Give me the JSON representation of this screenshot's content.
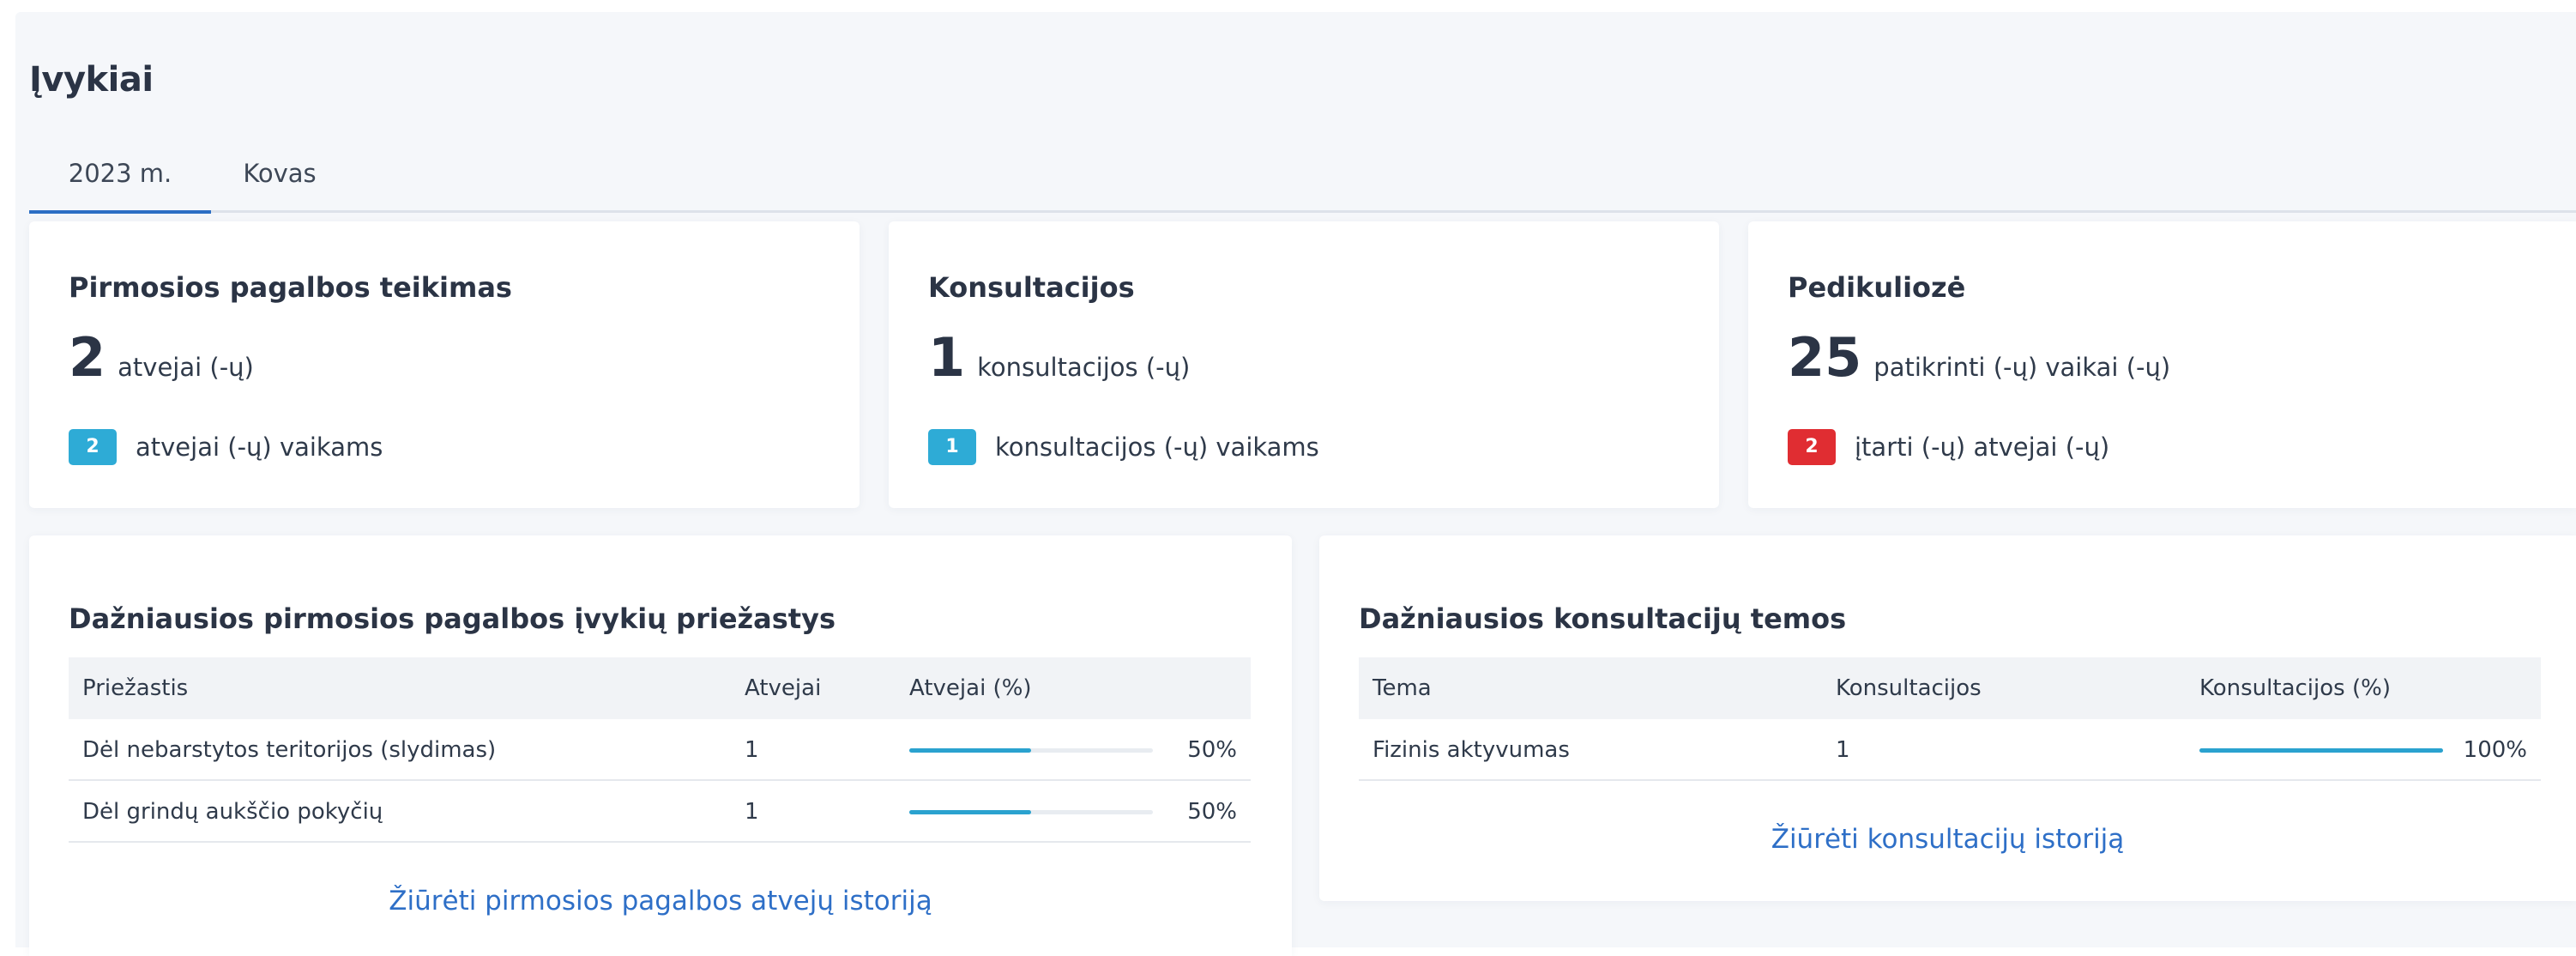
{
  "page": {
    "title": "Įvykiai"
  },
  "tabs": [
    {
      "label": "2023 m.",
      "active": true
    },
    {
      "label": "Kovas",
      "active": false
    }
  ],
  "colors": {
    "accent": "#2d6fc4",
    "badge_blue": "#2eabd6",
    "badge_red": "#e02d32",
    "bar": "#2aa2cf",
    "link": "#2e6fc7"
  },
  "stats": [
    {
      "title": "Pirmosios pagalbos teikimas",
      "value": "2",
      "unit": "atvejai (-ų)",
      "badge": "2",
      "badge_color": "blue",
      "sub_text": "atvejai (-ų) vaikams"
    },
    {
      "title": "Konsultacijos",
      "value": "1",
      "unit": "konsultacijos (-ų)",
      "badge": "1",
      "badge_color": "blue",
      "sub_text": "konsultacijos (-ų) vaikams"
    },
    {
      "title": "Pedikuliozė",
      "value": "25",
      "unit": "patikrinti (-ų) vaikai (-ų)",
      "badge": "2",
      "badge_color": "red",
      "sub_text": "įtarti (-ų) atvejai (-ų)"
    }
  ],
  "causes": {
    "title": "Dažniausios pirmosios pagalbos įvykių priežastys",
    "columns": [
      "Priežastis",
      "Atvejai",
      "Atvejai (%)"
    ],
    "rows": [
      {
        "name": "Dėl nebarstytos teritorijos (slydimas)",
        "count": "1",
        "percent": 50,
        "percent_label": "50%"
      },
      {
        "name": "Dėl grindų aukščio pokyčių",
        "count": "1",
        "percent": 50,
        "percent_label": "50%"
      }
    ],
    "link": "Žiūrėti pirmosios pagalbos atvejų istoriją"
  },
  "topics": {
    "title": "Dažniausios konsultacijų temos",
    "columns": [
      "Tema",
      "Konsultacijos",
      "Konsultacijos (%)"
    ],
    "rows": [
      {
        "name": "Fizinis aktyvumas",
        "count": "1",
        "percent": 100,
        "percent_label": "100%"
      }
    ],
    "link": "Žiūrėti konsultacijų istoriją"
  }
}
